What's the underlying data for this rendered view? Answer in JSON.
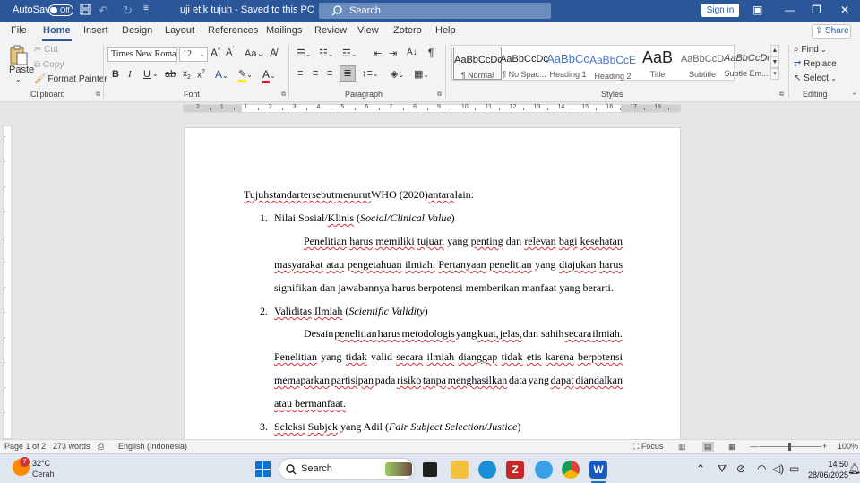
{
  "titlebar": {
    "autosave_label": "AutoSave",
    "autosave_state": "Off",
    "document_title": "uji etik tujuh",
    "save_status": "Saved to this PC",
    "search_placeholder": "Search",
    "signin_label": "Sign in"
  },
  "menu": {
    "tabs": [
      "File",
      "Home",
      "Insert",
      "Design",
      "Layout",
      "References",
      "Mailings",
      "Review",
      "View",
      "Zotero",
      "Help"
    ],
    "active": "Home",
    "share_label": "Share"
  },
  "ribbon": {
    "clipboard": {
      "paste": "Paste",
      "cut": "Cut",
      "copy": "Copy",
      "format_painter": "Format Painter",
      "label": "Clipboard"
    },
    "font": {
      "family": "Times New Roma",
      "size": "12",
      "label": "Font"
    },
    "paragraph": {
      "label": "Paragraph"
    },
    "styles": {
      "label": "Styles",
      "items": [
        {
          "sample": "AaBbCcDc",
          "name": "¶ Normal"
        },
        {
          "sample": "AaBbCcDc",
          "name": "¶ No Spac..."
        },
        {
          "sample": "AaBbCc",
          "name": "Heading 1"
        },
        {
          "sample": "AaBbCcE",
          "name": "Heading 2"
        },
        {
          "sample": "AaB",
          "name": "Title"
        },
        {
          "sample": "AaBbCcD",
          "name": "Subtitle"
        },
        {
          "sample": "AaBbCcDc",
          "name": "Subtle Em..."
        }
      ]
    },
    "editing": {
      "find": "Find",
      "replace": "Replace",
      "select": "Select",
      "label": "Editing"
    }
  },
  "ruler": {
    "numbers": [
      "2",
      "1",
      "1",
      "2",
      "3",
      "4",
      "5",
      "6",
      "7",
      "8",
      "9",
      "10",
      "11",
      "12",
      "13",
      "14",
      "15",
      "16",
      "17",
      "18"
    ]
  },
  "document": {
    "intro": [
      "Tujuh",
      "standar",
      "tersebut",
      "menurut",
      "WHO (2020)",
      "antara",
      "lain:"
    ],
    "items": [
      {
        "number": "1.",
        "title_a": "Nilai Sosial/",
        "title_b": "Klinis",
        "title_c": " (",
        "title_italic": "Social/Clinical Value",
        "title_d": ")",
        "lines": [
          [
            "Penelitian",
            "harus",
            "memiliki",
            "tujuan",
            "yang",
            "penting",
            "dan",
            "relevan",
            "bagi",
            "kesehatan"
          ],
          [
            "masyarakat",
            "atau",
            "pengetahuan",
            "ilmiah.",
            "Pertanyaan",
            "penelitian",
            "yang",
            "diajukan",
            "harus"
          ],
          [
            "signifikan dan jawabannya harus berpotensi memberikan manfaat yang berarti."
          ]
        ]
      },
      {
        "number": "2.",
        "title_a": "Validitas",
        "title_b": "Ilmiah",
        "title_c": " (",
        "title_italic": "Scientific Validity",
        "title_d": ")",
        "lines": [
          [
            "Desain",
            "penelitian",
            "harus",
            "metodologis",
            "yang",
            "kuat,",
            "jelas,",
            "dan sahih",
            "secara",
            "ilmiah."
          ],
          [
            "Penelitian",
            "yang",
            "tidak",
            "valid",
            "secara",
            "ilmiah",
            "dianggap",
            "tidak",
            "etis",
            "karena",
            "berpotensi"
          ],
          [
            "memaparkan",
            "partisipan",
            "pada",
            "risiko",
            "tanpa",
            "menghasilkan",
            "data",
            "yang",
            "dapat",
            "diandalkan"
          ],
          [
            "atau bermanfaat."
          ]
        ]
      },
      {
        "number": "3.",
        "title_a": "Seleksi",
        "title_b": "Subjek",
        "title_c": " yang Adil (",
        "title_italic": "Fair Subject Selection/Justice",
        "title_d": ")"
      }
    ]
  },
  "status": {
    "page": "Page 1 of 2",
    "words": "273 words",
    "language": "English (Indonesia)",
    "focus": "Focus",
    "zoom": "100%"
  },
  "taskbar": {
    "temperature": "32°C",
    "condition": "Cerah",
    "search": "Search",
    "time": "14:50",
    "date": "28/06/2025",
    "weather_badge": "7"
  }
}
